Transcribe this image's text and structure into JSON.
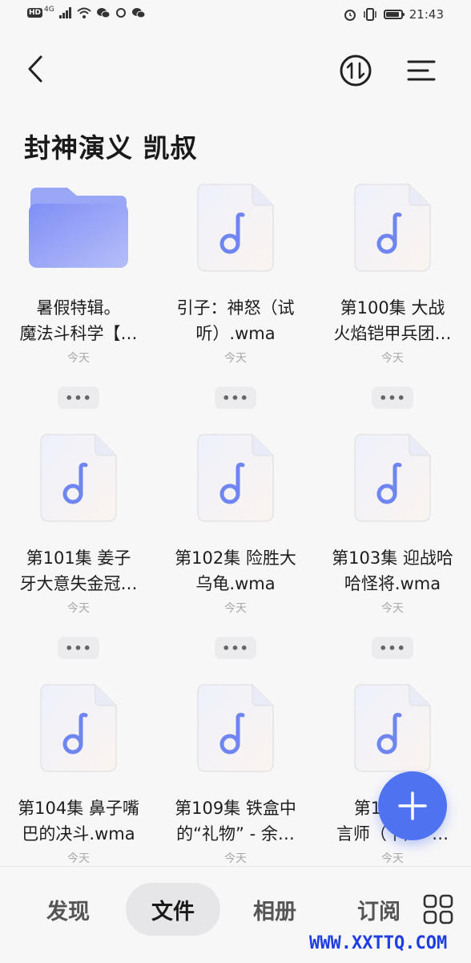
{
  "status_bar": {
    "hd": "HD",
    "net": "4G",
    "time": "21:43",
    "icons": [
      "signal-icon",
      "wifi-icon",
      "wechat-icon",
      "sync-icon",
      "wechat-icon",
      "alarm-icon",
      "vibrate-icon",
      "battery-icon"
    ]
  },
  "header": {
    "back_icon": "back-arrow-icon",
    "sort_icon": "sort-icon",
    "menu_icon": "menu-icon"
  },
  "page_title": "封神演义 凯叔",
  "more_label": "•••",
  "items": [
    {
      "type": "folder",
      "name": "暑假特辑。魔法斗科学【…",
      "line1": "暑假特辑。",
      "line2": "魔法斗科学【…",
      "date": "今天"
    },
    {
      "type": "audio",
      "line1": "引子：神怒（试",
      "line2": "听）.wma",
      "date": "今天"
    },
    {
      "type": "audio",
      "line1": "第100集 大战",
      "line2": "火焰铠甲兵团…",
      "date": "今天"
    },
    {
      "type": "audio",
      "line1": "第101集 姜子",
      "line2": "牙大意失金冠…",
      "date": "今天"
    },
    {
      "type": "audio",
      "line1": "第102集 险胜大",
      "line2": "乌龟.wma",
      "date": "今天"
    },
    {
      "type": "audio",
      "line1": "第103集 迎战哈",
      "line2": "哈怪将.wma",
      "date": "今天"
    },
    {
      "type": "audio",
      "line1": "第104集 鼻子嘴",
      "line2": "巴的决斗.wma",
      "date": "今天"
    },
    {
      "type": "audio",
      "line1": "第109集 铁盒中",
      "line2": "的“礼物” - 余…",
      "date": "今天"
    },
    {
      "type": "audio",
      "line1": "第10集 预",
      "line2": "言师（下）- …",
      "date": "今天"
    }
  ],
  "fab": {
    "icon": "plus-icon"
  },
  "bottom_nav": {
    "items": [
      "发现",
      "文件",
      "相册",
      "订阅"
    ],
    "active": "文件",
    "grid_icon": "apps-grid-icon"
  },
  "watermark": "WWW.XXTTQ.COM",
  "colors": {
    "accent": "#4f73f0",
    "folder": "#8f9cf5",
    "music_note": "#6f86f0",
    "background": "#f7f7f8"
  }
}
